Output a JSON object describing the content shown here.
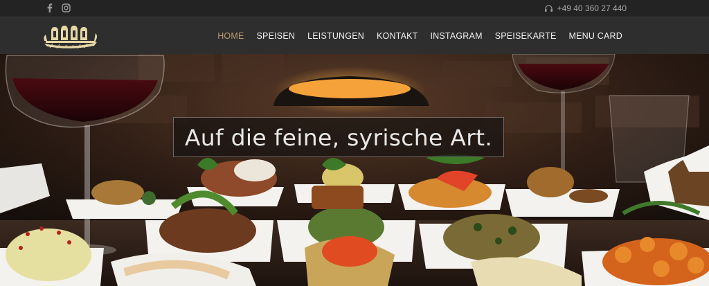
{
  "topbar": {
    "social": [
      {
        "icon": "facebook-icon"
      },
      {
        "icon": "instagram-icon"
      }
    ],
    "phone_icon": "headset-icon",
    "phone": "+49 40 360 27 440"
  },
  "nav": {
    "logo_icon": "ship-logo-icon",
    "items": [
      {
        "label": "HOME",
        "active": true
      },
      {
        "label": "SPEISEN",
        "active": false
      },
      {
        "label": "LEISTUNGEN",
        "active": false
      },
      {
        "label": "KONTAKT",
        "active": false
      },
      {
        "label": "INSTAGRAM",
        "active": false
      },
      {
        "label": "SPEISEKARTE",
        "active": false
      },
      {
        "label": "MENU CARD",
        "active": false
      }
    ],
    "active_color": "#b89a6c"
  },
  "hero": {
    "tagline": "Auf die feine, syrische Art."
  }
}
